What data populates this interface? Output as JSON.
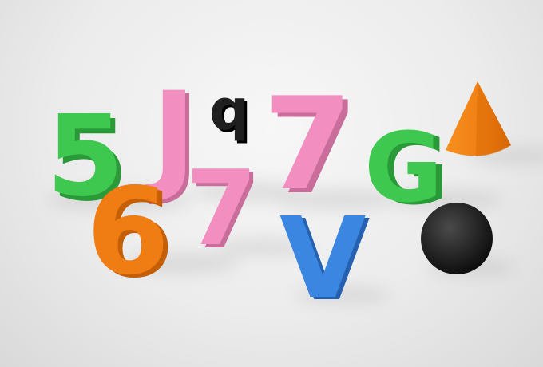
{
  "scene": {
    "objects": [
      {
        "id": "char-5",
        "label": "5",
        "color": "#3fc84f",
        "shade": "#2a9a38"
      },
      {
        "id": "char-6",
        "label": "6",
        "color": "#f07d14",
        "shade": "#c45f08"
      },
      {
        "id": "char-j",
        "label": "J",
        "color": "#f28ec0",
        "shade": "#c96d9b"
      },
      {
        "id": "char-q",
        "label": "q",
        "color": "#1f1f1f",
        "shade": "#000000"
      },
      {
        "id": "char-7-small",
        "label": "7",
        "color": "#f28ec0",
        "shade": "#c96d9b"
      },
      {
        "id": "char-7-large",
        "label": "7",
        "color": "#f28ec0",
        "shade": "#c96d9b"
      },
      {
        "id": "char-v",
        "label": "V",
        "color": "#3a86e0",
        "shade": "#2661b0"
      },
      {
        "id": "char-g",
        "label": "G",
        "color": "#3fc84f",
        "shade": "#2a9a38"
      },
      {
        "id": "cone",
        "shape": "cone",
        "color": "#f07d14"
      },
      {
        "id": "sphere",
        "shape": "sphere",
        "color": "#202020"
      }
    ]
  }
}
